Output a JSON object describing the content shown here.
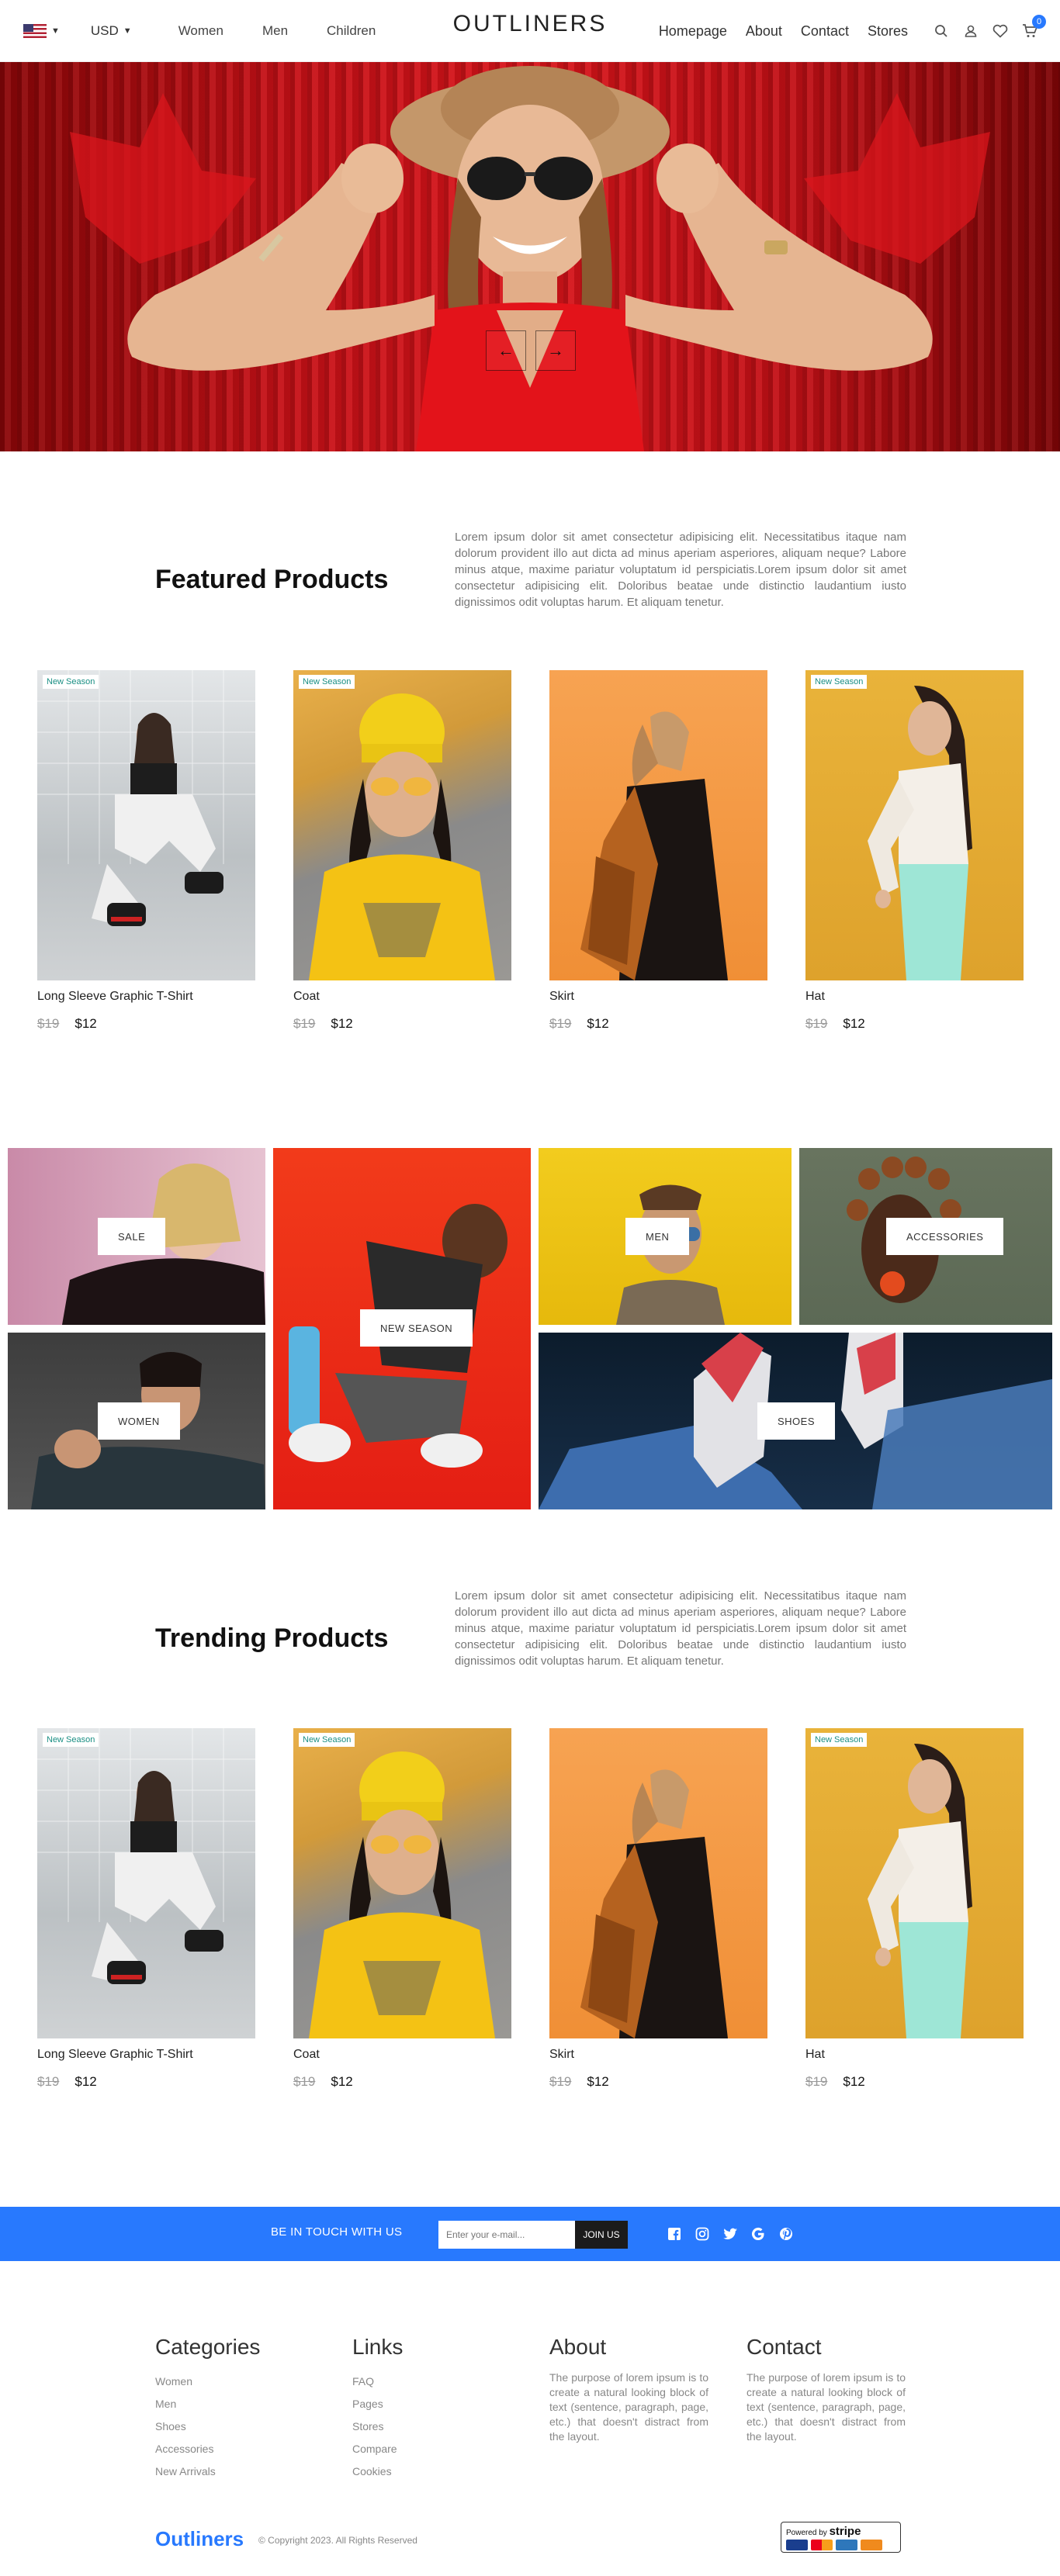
{
  "nav": {
    "currency": "USD",
    "links_left": [
      "Women",
      "Men",
      "Children"
    ],
    "logo": "OUTLINERS",
    "links_right": [
      "Homepage",
      "About",
      "Contact",
      "Stores"
    ],
    "cart_count": "0",
    "icons": [
      "search-icon",
      "user-icon",
      "heart-icon",
      "cart-icon"
    ]
  },
  "hero": {
    "prev_icon": "←",
    "next_icon": "→"
  },
  "featured": {
    "title": "Featured Products",
    "description": "Lorem ipsum dolor sit amet consectetur adipisicing elit. Necessitatibus itaque nam dolorum provident illo aut dicta ad minus aperiam asperiores, aliquam neque? Labore minus atque, maxime pariatur voluptatum id perspiciatis.Lorem ipsum dolor sit amet consectetur adipisicing elit. Doloribus beatae unde distinctio laudantium iusto dignissimos odit voluptas harum. Et aliquam tenetur.",
    "products": [
      {
        "name": "Long Sleeve Graphic T-Shirt",
        "old_price": "$19",
        "price": "$12",
        "tag": "New Season"
      },
      {
        "name": "Coat",
        "old_price": "$19",
        "price": "$12",
        "tag": "New Season"
      },
      {
        "name": "Skirt",
        "old_price": "$19",
        "price": "$12",
        "tag": ""
      },
      {
        "name": "Hat",
        "old_price": "$19",
        "price": "$12",
        "tag": "New Season"
      }
    ]
  },
  "categories": {
    "sale": "SALE",
    "women": "WOMEN",
    "new_season": "NEW SEASON",
    "men": "MEN",
    "accessories": "ACCESSORIES",
    "shoes": "SHOES"
  },
  "trending": {
    "title": "Trending Products",
    "description": "Lorem ipsum dolor sit amet consectetur adipisicing elit. Necessitatibus itaque nam dolorum provident illo aut dicta ad minus aperiam asperiores, aliquam neque? Labore minus atque, maxime pariatur voluptatum id perspiciatis.Lorem ipsum dolor sit amet consectetur adipisicing elit. Doloribus beatae unde distinctio laudantium iusto dignissimos odit voluptas harum. Et aliquam tenetur.",
    "products": [
      {
        "name": "Long Sleeve Graphic T-Shirt",
        "old_price": "$19",
        "price": "$12",
        "tag": "New Season"
      },
      {
        "name": "Coat",
        "old_price": "$19",
        "price": "$12",
        "tag": "New Season"
      },
      {
        "name": "Skirt",
        "old_price": "$19",
        "price": "$12",
        "tag": ""
      },
      {
        "name": "Hat",
        "old_price": "$19",
        "price": "$12",
        "tag": "New Season"
      }
    ]
  },
  "newsletter": {
    "title": "BE IN TOUCH WITH US",
    "placeholder": "Enter your e-mail...",
    "button": "JOIN US",
    "social_icons": [
      "facebook-icon",
      "instagram-icon",
      "twitter-icon",
      "google-icon",
      "pinterest-icon"
    ]
  },
  "footer": {
    "categories": {
      "title": "Categories",
      "items": [
        "Women",
        "Men",
        "Shoes",
        "Accessories",
        "New Arrivals"
      ]
    },
    "links": {
      "title": "Links",
      "items": [
        "FAQ",
        "Pages",
        "Stores",
        "Compare",
        "Cookies"
      ]
    },
    "about": {
      "title": "About",
      "text": "The purpose of lorem ipsum is to create a natural looking block of text (sentence, paragraph, page, etc.) that doesn't distract from the layout."
    },
    "contact": {
      "title": "Contact",
      "text": "The purpose of lorem ipsum is to create a natural looking block of text (sentence, paragraph, page, etc.) that doesn't distract from the layout."
    },
    "brand": "Outliners",
    "copyright": "© Copyright 2023. All Rights Reserved",
    "payment": {
      "powered_by": "Powered by",
      "stripe": "stripe"
    }
  },
  "colors": {
    "accent": "#2879fe",
    "tag_text": "#1a8f84",
    "hero_red": "#c41016"
  }
}
